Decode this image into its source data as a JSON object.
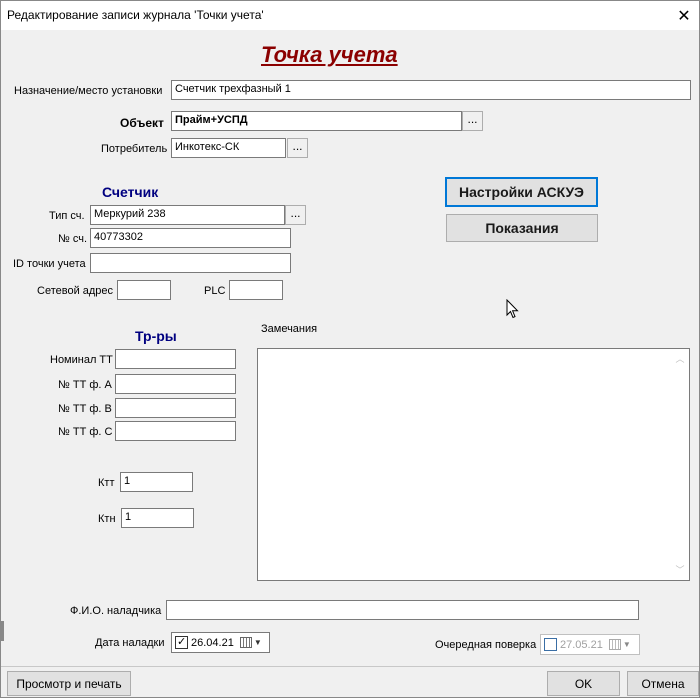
{
  "window": {
    "title": "Редактирование записи журнала 'Точки учета'"
  },
  "form": {
    "heading": "Точка учета",
    "purpose_label": "Назначение/место установки",
    "purpose_value": "Счетчик трехфазный 1",
    "object_label": "Объект",
    "object_value": "Прайм+УСПД",
    "consumer_label": "Потребитель",
    "consumer_value": "Инкотекс-СК",
    "ellipsis": "..."
  },
  "meter": {
    "section_title": "Счетчик",
    "type_label": "Тип сч.",
    "type_value": "Меркурий 238",
    "number_label": "№ сч.",
    "number_value": "40773302",
    "point_id_label": "ID точки учета",
    "point_id_value": "",
    "net_address_label": "Сетевой адрес",
    "net_address_value": "",
    "plc_label": "PLC",
    "plc_value": ""
  },
  "buttons": {
    "askue_settings": "Настройки АСКУЭ",
    "readings": "Показания",
    "print_preview": "Просмотр и печать",
    "ok": "OK",
    "cancel": "Отмена"
  },
  "transformers": {
    "section_title": "Тр-ры",
    "nominal_tt_label": "Номинал ТТ",
    "nominal_tt_value": "",
    "tt_a_label": "№ ТТ ф. А",
    "tt_a_value": "",
    "tt_b_label": "№ ТТ ф. В",
    "tt_b_value": "",
    "tt_c_label": "№ ТТ ф. С",
    "tt_c_value": "",
    "ktt_label": "Ктт",
    "ktt_value": "1",
    "ktn_label": "Ктн",
    "ktn_value": "1"
  },
  "remarks": {
    "label": "Замечания",
    "value": ""
  },
  "adjuster": {
    "name_label": "Ф.И.О. наладчика",
    "name_value": "",
    "date_label": "Дата наладки",
    "date_value": "26.04.21",
    "date_checked": true,
    "next_check_label": "Очередная поверка",
    "next_check_value": "27.05.21",
    "next_check_checked": false
  },
  "icons": {
    "close": "close-icon",
    "calendar": "calendar-icon",
    "dropdown": "chevron-down-icon",
    "cursor": "mouse-pointer-icon"
  },
  "colors": {
    "heading": "#8b0000",
    "section": "#000080",
    "focus": "#0078d7"
  }
}
